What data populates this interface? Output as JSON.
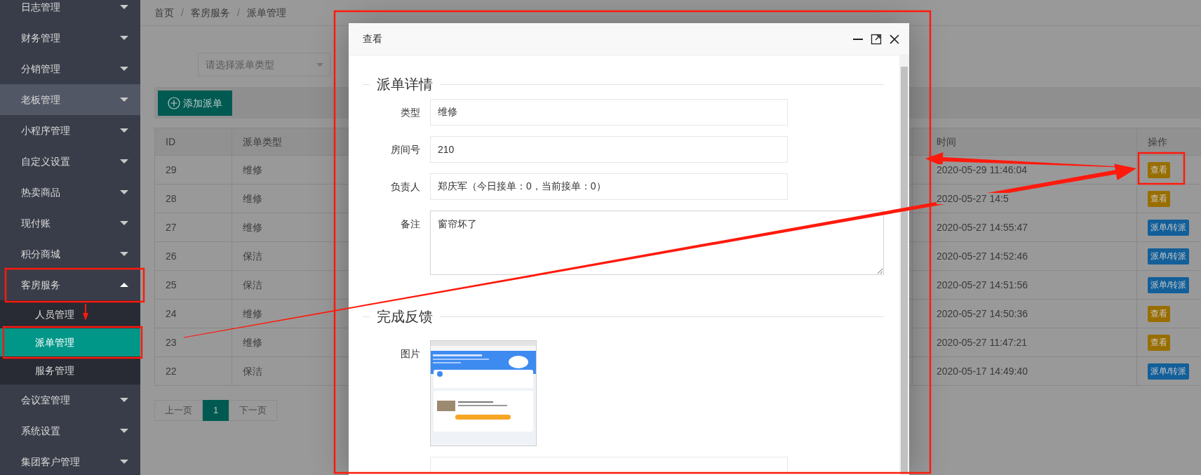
{
  "sidebar": {
    "items": [
      {
        "label": "日志管理",
        "expanded": false,
        "highlighted": false
      },
      {
        "label": "财务管理",
        "expanded": false,
        "highlighted": false
      },
      {
        "label": "分销管理",
        "expanded": false,
        "highlighted": false
      },
      {
        "label": "老板管理",
        "expanded": false,
        "highlighted": true
      },
      {
        "label": "小程序管理",
        "expanded": false,
        "highlighted": false
      },
      {
        "label": "自定义设置",
        "expanded": false,
        "highlighted": false
      },
      {
        "label": "热卖商品",
        "expanded": false,
        "highlighted": false
      },
      {
        "label": "现付账",
        "expanded": false,
        "highlighted": false
      },
      {
        "label": "积分商城",
        "expanded": false,
        "highlighted": false
      },
      {
        "label": "客房服务",
        "expanded": true,
        "highlighted": false,
        "children": [
          {
            "label": "人员管理",
            "selected": false
          },
          {
            "label": "派单管理",
            "selected": true
          },
          {
            "label": "服务管理",
            "selected": false
          }
        ]
      },
      {
        "label": "会议室管理",
        "expanded": false,
        "highlighted": false
      },
      {
        "label": "系统设置",
        "expanded": false,
        "highlighted": false
      },
      {
        "label": "集团客户管理",
        "expanded": false,
        "highlighted": false
      }
    ]
  },
  "breadcrumb": [
    {
      "kind": "link",
      "text": "首页"
    },
    {
      "kind": "separator",
      "text": "/"
    },
    {
      "kind": "link",
      "text": "客房服务"
    },
    {
      "kind": "separator",
      "text": "/"
    },
    {
      "kind": "current",
      "text": "派单管理"
    }
  ],
  "filter": {
    "placeholder": "请选择派单类型"
  },
  "toolbar": {
    "add_button": "添加派单"
  },
  "table": {
    "columns": [
      "ID",
      "派单类型",
      "时间",
      "操作"
    ],
    "rows": [
      {
        "id": "29",
        "type": "维修",
        "time": "2020-05-29 11:46:04",
        "actions": [
          {
            "kind": "view",
            "label": "查看"
          }
        ]
      },
      {
        "id": "28",
        "type": "维修",
        "time": "2020-05-27 14:5",
        "actions": [
          {
            "kind": "view",
            "label": "查看"
          }
        ]
      },
      {
        "id": "27",
        "type": "维修",
        "time": "2020-05-27 14:55:47",
        "actions": [
          {
            "kind": "dispatch",
            "label": "派单/转派"
          }
        ]
      },
      {
        "id": "26",
        "type": "保洁",
        "time": "2020-05-27 14:52:46",
        "actions": [
          {
            "kind": "dispatch",
            "label": "派单/转派"
          }
        ]
      },
      {
        "id": "25",
        "type": "保洁",
        "time": "2020-05-27 14:51:56",
        "actions": [
          {
            "kind": "dispatch",
            "label": "派单/转派"
          }
        ]
      },
      {
        "id": "24",
        "type": "维修",
        "time": "2020-05-27 14:50:36",
        "actions": [
          {
            "kind": "view",
            "label": "查看"
          }
        ]
      },
      {
        "id": "23",
        "type": "维修",
        "time": "2020-05-27 11:47:21",
        "actions": [
          {
            "kind": "view",
            "label": "查看"
          }
        ]
      },
      {
        "id": "22",
        "type": "保洁",
        "time": "2020-05-17 14:49:40",
        "actions": [
          {
            "kind": "dispatch",
            "label": "派单/转派"
          }
        ]
      }
    ]
  },
  "pagination": {
    "prev": "上一页",
    "pages": [
      {
        "label": "1",
        "selected": true
      }
    ],
    "next": "下一页"
  },
  "modal": {
    "title": "查看",
    "sections": [
      {
        "legend": "派单详情",
        "fields": [
          {
            "kind": "input",
            "label": "类型",
            "value": "维修"
          },
          {
            "kind": "input",
            "label": "房间号",
            "value": "210"
          },
          {
            "kind": "input",
            "label": "负责人",
            "value": "郑庆军（今日接单：0，当前接单：0）"
          },
          {
            "kind": "textarea",
            "label": "备注",
            "value": "窗帘坏了"
          }
        ]
      },
      {
        "legend": "完成反馈",
        "fields": [
          {
            "kind": "image",
            "label": "图片"
          },
          {
            "kind": "input"
          }
        ]
      }
    ]
  }
}
